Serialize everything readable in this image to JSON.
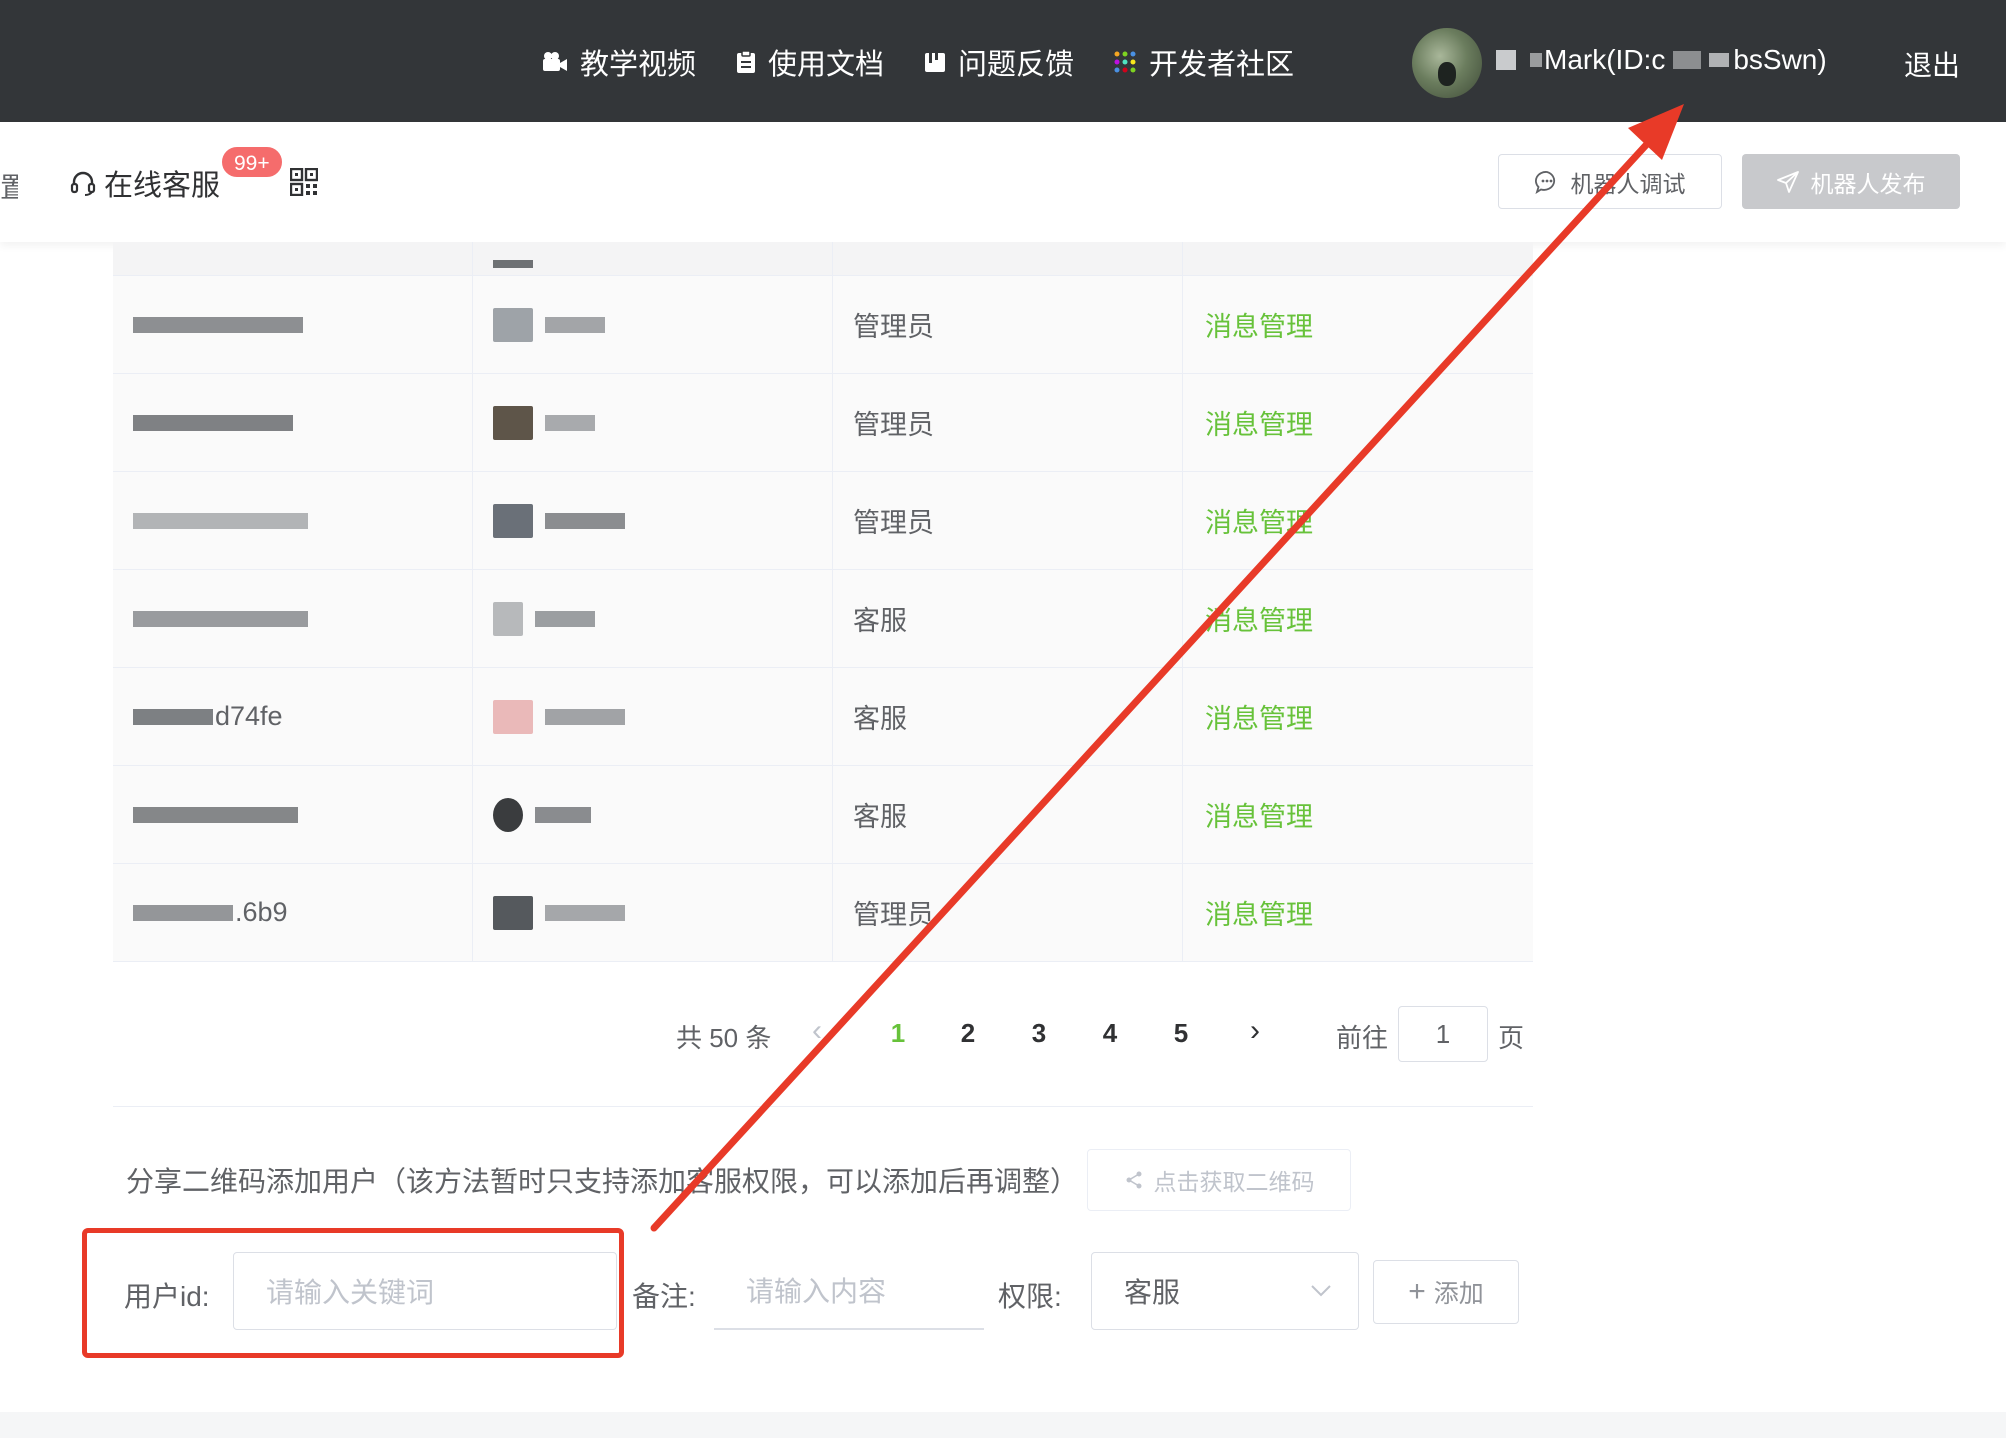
{
  "topnav": {
    "items": [
      {
        "label": "教学视频",
        "icon": "video-camera-icon"
      },
      {
        "label": "使用文档",
        "icon": "document-icon"
      },
      {
        "label": "问题反馈",
        "icon": "feedback-icon"
      },
      {
        "label": "开发者社区",
        "icon": "community-grid-icon"
      }
    ],
    "user_name_part": "Mark(ID:c",
    "user_id_suffix": "bsSwn)",
    "logout_label": "退出"
  },
  "subnav": {
    "truncated_item": "置",
    "online_service_label": "在线客服",
    "badge_count": "99+",
    "debug_button": "机器人调试",
    "publish_button": "机器人发布"
  },
  "table": {
    "rows": [
      {
        "id": "",
        "role": "",
        "action": ""
      },
      {
        "id": "",
        "role": "管理员",
        "action": "消息管理"
      },
      {
        "id": "",
        "role": "管理员",
        "action": "消息管理"
      },
      {
        "id": "",
        "role": "管理员",
        "action": "消息管理"
      },
      {
        "id": "",
        "role": "客服",
        "action": "消息管理"
      },
      {
        "id": "d74fe",
        "role": "客服",
        "action": "消息管理"
      },
      {
        "id": "",
        "role": "客服",
        "action": "消息管理"
      },
      {
        "id": ".6b9",
        "role": "管理员",
        "action": "消息管理"
      }
    ]
  },
  "pagination": {
    "total": "共 50 条",
    "pages": [
      "1",
      "2",
      "3",
      "4",
      "5"
    ],
    "current": "1",
    "goto_label": "前往",
    "goto_value": "1",
    "page_suffix": "页"
  },
  "share": {
    "text": "分享二维码添加用户（该方法暂时只支持添加客服权限，可以添加后再调整）",
    "qr_button": "点击获取二维码"
  },
  "add_form": {
    "user_id_label": "用户id:",
    "user_id_placeholder": "请输入关键词",
    "remark_label": "备注:",
    "remark_placeholder": "请输入内容",
    "permission_label": "权限:",
    "permission_value": "客服",
    "add_button": "添加"
  },
  "colors": {
    "topbar": "#333639",
    "accent_green": "#67c23a",
    "annotation_red": "#e83a28",
    "badge_red": "#f56c6c"
  }
}
